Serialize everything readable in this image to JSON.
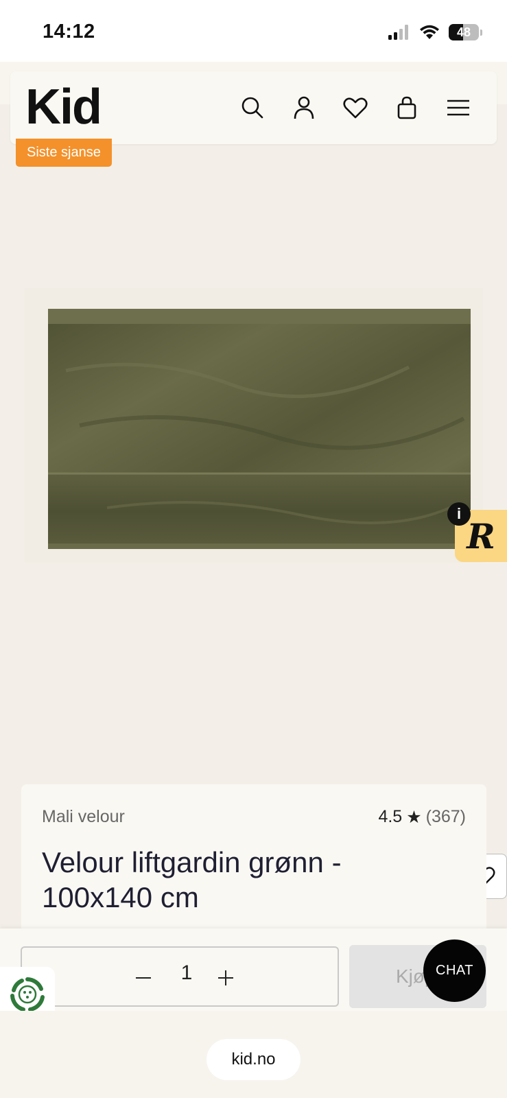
{
  "status_bar": {
    "time": "14:12",
    "battery": "48",
    "battery_level": 0.48
  },
  "header": {
    "logo": "Kid",
    "icons": [
      "search-icon",
      "account-icon",
      "wishlist-icon",
      "cart-icon",
      "menu-icon"
    ]
  },
  "product": {
    "badge": "Siste sjanse",
    "brand": "Mali velour",
    "rating": "4.5",
    "rating_star": "★",
    "review_count": "(367)",
    "title": "Velour liftgardin grønn - 100x140 cm"
  },
  "widgets": {
    "r_badge": "R",
    "info": "i"
  },
  "purchase": {
    "quantity": "1",
    "buy_label": "Kjøp",
    "chat_label": "CHAT"
  },
  "browser": {
    "url": "kid.no"
  },
  "colors": {
    "badge": "#f4912a",
    "page_background": "#f3efe8",
    "r_widget": "#fbd683",
    "product_green": "#5b5b3c"
  }
}
